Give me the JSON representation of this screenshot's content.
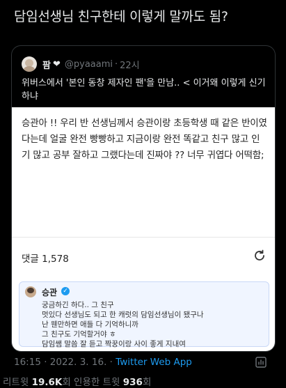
{
  "title": "담임선생님 친구한테 이렇게 말까도 됨?",
  "quoted": {
    "name": "팜",
    "heart": "❤",
    "handle": "@pyaaami",
    "sep": "·",
    "time": "22시",
    "text": "위버스에서 '본인 동창 제자인 팬'을 만남..  < 이거왜 이렇게 신기하냐"
  },
  "card": {
    "body": "승관아 !! 우리 반 선생님께서 승관이랑 초등학생 때 같은 반이였다는데 얼굴 완전 빵빵하고 지금이랑 완전 똑같고 친구 많고 인기 많고 공부 잘하고 그랬다는데 진짜야 ?? 너무 귀엽다 어떡함;",
    "comments_label": "댓글 1,578",
    "reply": {
      "name": "승관",
      "lines": [
        "궁금하긴 하다.. 그 친구",
        "멋있다 선생님도 되고 한 캐럿의 담임선생님이 됐구나",
        "난 웬만하면 애들 다 기억하니까",
        "그 친구도 기억할거야 ㅎ",
        "담임쌤 말씀 잘 듣고 짝꿍이랑 사이 좋게 지내여"
      ]
    }
  },
  "meta": {
    "time": "16:15 · 2022. 3. 16. · ",
    "via": "Twitter Web App"
  },
  "stats": {
    "retweet_label": "리트윗 ",
    "retweet_count": "19.6K",
    "retweet_suffix": "회  인용한 트윗 ",
    "quote_count": "936",
    "quote_suffix": "회"
  },
  "colors": {
    "accent": "#1d9bf0",
    "muted": "#71767b",
    "text": "#e7e9ea",
    "background": "#000000"
  }
}
